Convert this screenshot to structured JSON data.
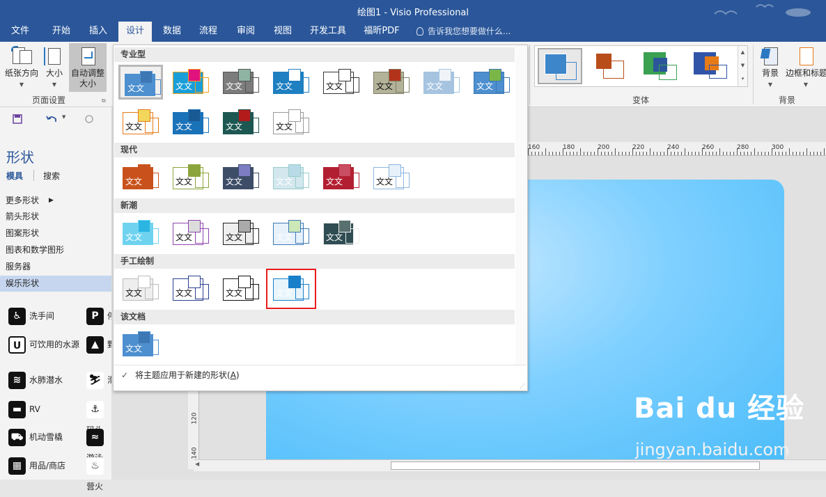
{
  "window": {
    "title": "绘图1 - Visio Professional"
  },
  "tabs": [
    {
      "label": "文件"
    },
    {
      "label": "开始"
    },
    {
      "label": "插入"
    },
    {
      "label": "设计"
    },
    {
      "label": "数据"
    },
    {
      "label": "流程"
    },
    {
      "label": "审阅"
    },
    {
      "label": "视图"
    },
    {
      "label": "开发工具"
    },
    {
      "label": "福昕PDF"
    }
  ],
  "tell_me": "告诉我您想要做什么...",
  "ribbon": {
    "paper_orientation": "纸张方向",
    "size": "大小",
    "auto_size_line1": "自动调整",
    "auto_size_line2": "大小",
    "page_setup_label": "页面设置",
    "variants_label": "变体",
    "background": "背景",
    "borders_titles": "边框和标题",
    "background_group_label": "背景"
  },
  "shapes_pane": {
    "title": "形状",
    "tab_stencils": "模具",
    "tab_search": "搜索",
    "stencils": [
      "更多形状",
      "箭头形状",
      "图案形状",
      "图表和数学图形",
      "服务器",
      "娱乐形状"
    ],
    "items_left": [
      {
        "label": "洗手间",
        "icon": "restroom-icon"
      },
      {
        "label": "可饮用的水源",
        "icon": "drinking-water-icon"
      },
      {
        "label": "水肺潜水",
        "icon": "scuba-diving-icon"
      },
      {
        "label": "RV",
        "icon": "rv-icon"
      },
      {
        "label": "机动雪橇",
        "icon": "snowmobile-icon"
      },
      {
        "label": "用品/商店",
        "icon": "store-icon"
      }
    ],
    "items_right": [
      {
        "label": "停",
        "icon": "parking-icon",
        "glyph": "P"
      },
      {
        "label": "野",
        "icon": "camping-icon",
        "glyph": "▲"
      },
      {
        "label": "滑",
        "icon": "skiing-icon",
        "glyph": "⛷"
      },
      {
        "label": "码头",
        "icon": "anchor-icon",
        "glyph": "⚓"
      },
      {
        "label": "游泳",
        "icon": "swimming-icon",
        "glyph": "≈"
      },
      {
        "label": "营火",
        "icon": "campfire-icon",
        "glyph": "♨"
      }
    ]
  },
  "ruler": {
    "h_labels": [
      "160",
      "180",
      "200",
      "220",
      "240",
      "260",
      "280",
      "300"
    ],
    "v_labels": [
      "120",
      "140"
    ]
  },
  "theme_dropdown": {
    "sections": [
      {
        "title": "专业型"
      },
      {
        "title": "现代"
      },
      {
        "title": "新潮"
      },
      {
        "title": "手工绘制"
      },
      {
        "title": "该文档"
      }
    ],
    "thumb_text": "文文",
    "footer_prefix": "将主题应用于新建的形状(",
    "footer_key": "A",
    "footer_suffix": ")"
  },
  "watermark": {
    "brand": "Bai du 经验",
    "url": "jingyan.baidu.com"
  },
  "colors": {
    "brand_blue": "#2b579a",
    "highlight_red": "#e81a1a"
  }
}
